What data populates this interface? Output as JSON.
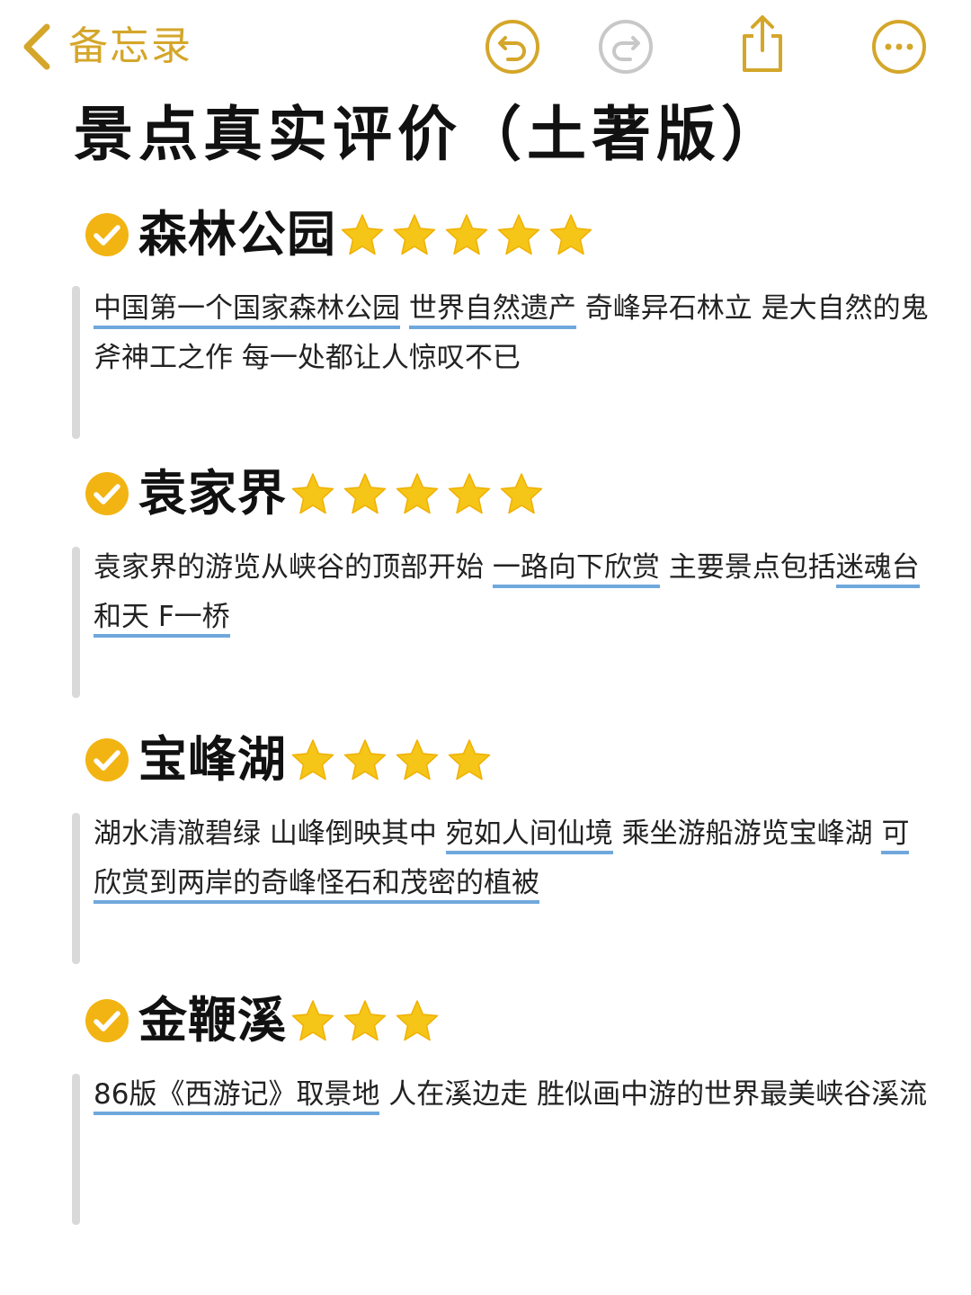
{
  "nav": {
    "back_label": "备忘录"
  },
  "icons": {
    "back": "chevron-left-icon",
    "undo": "undo-icon",
    "redo": "redo-icon",
    "share": "share-icon",
    "more": "more-icon",
    "check": "check-circle-icon",
    "star": "star-icon"
  },
  "colors": {
    "accent": "#d4a62a",
    "redo_disabled": "#c8c8c8",
    "underline": "#6fa8dc",
    "star": "#f5c518"
  },
  "title": "景点真实评价（土著版）",
  "sections": [
    {
      "name": "森林公园",
      "stars": 5,
      "desc": [
        {
          "text": "中国第一个国家森林公园",
          "hl": true
        },
        {
          "text": " ",
          "hl": false
        },
        {
          "text": "世界自然遗产",
          "hl": true
        },
        {
          "text": " 奇峰异石林立 是大自然的鬼斧神工之作 每一处都让人惊叹不已",
          "hl": false
        }
      ]
    },
    {
      "name": "袁家界",
      "stars": 5,
      "desc": [
        {
          "text": "袁家界的游览从峡谷的顶部开始 ",
          "hl": false
        },
        {
          "text": "一路向下欣赏",
          "hl": true
        },
        {
          "text": " 主要景点包括",
          "hl": false
        },
        {
          "text": "迷魂台和天 F一桥",
          "hl": true
        }
      ]
    },
    {
      "name": "宝峰湖",
      "stars": 4,
      "desc": [
        {
          "text": "湖水清澈碧绿 山峰倒映其中 ",
          "hl": false
        },
        {
          "text": "宛如人间仙境",
          "hl": true
        },
        {
          "text": " 乘坐游船游览宝峰湖 ",
          "hl": false
        },
        {
          "text": "可欣赏到两岸的奇峰怪石和茂密的植被",
          "hl": true
        }
      ]
    },
    {
      "name": "金鞭溪",
      "stars": 3,
      "desc": [
        {
          "text": "86版《西游记》取景地",
          "hl": true
        },
        {
          "text": " 人在溪边走 胜似画中游的世界最美峡谷溪流",
          "hl": false
        }
      ]
    }
  ]
}
